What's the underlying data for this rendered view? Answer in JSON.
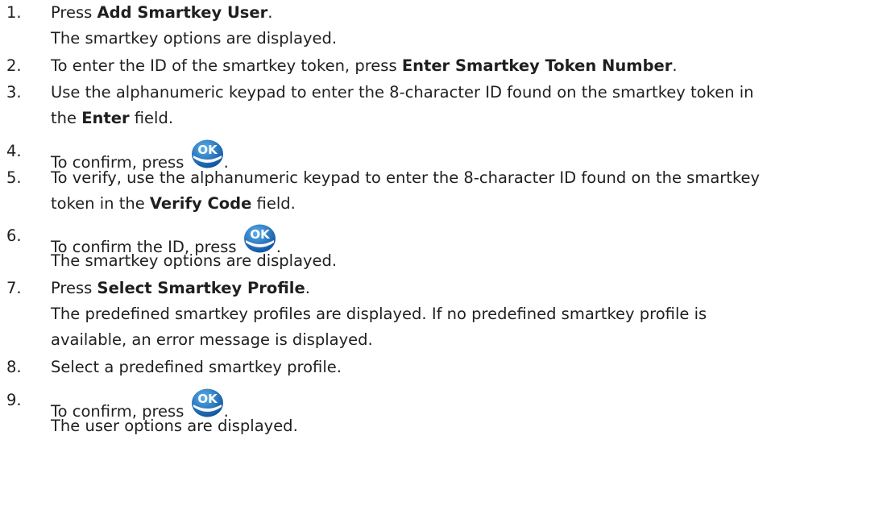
{
  "steps": [
    {
      "number": "1.",
      "pre": "Press ",
      "bold": "Add Smartkey User",
      "post": ".",
      "result": "The smartkey options are displayed."
    },
    {
      "number": "2.",
      "pre": "To enter the ID of the smartkey token, press ",
      "bold": "Enter Smartkey Token Number",
      "post": "."
    },
    {
      "number": "3.",
      "line1": "Use the alphanumeric keypad to enter the 8-character ID found on the smartkey token in",
      "line2_pre": "the ",
      "line2_bold": "Enter",
      "line2_post": " field."
    },
    {
      "number": "4.",
      "pre": "To confirm, press ",
      "post": "."
    },
    {
      "number": "5.",
      "line1": "To verify, use the alphanumeric keypad to enter the 8-character ID found on the smartkey",
      "line2_pre": "token in the ",
      "line2_bold": "Verify Code",
      "line2_post": " field."
    },
    {
      "number": "6.",
      "pre": "To confirm the ID, press ",
      "post": ".",
      "result": "The smartkey options are displayed."
    },
    {
      "number": "7.",
      "pre": "Press ",
      "bold": "Select Smartkey Profile",
      "post": ".",
      "result_line1": "The predefined smartkey profiles are displayed. If no predefined smartkey profile is",
      "result_line2": "available, an error message is displayed."
    },
    {
      "number": "8.",
      "text": "Select a predefined smartkey profile."
    },
    {
      "number": "9.",
      "pre": "To confirm, press ",
      "post": ".",
      "result": "The user options are displayed."
    }
  ],
  "icons": {
    "ok_button": {
      "name": "ok-button-icon",
      "label": "OK",
      "color_light": "#4a9de0",
      "color_dark": "#0b4f9a"
    }
  }
}
